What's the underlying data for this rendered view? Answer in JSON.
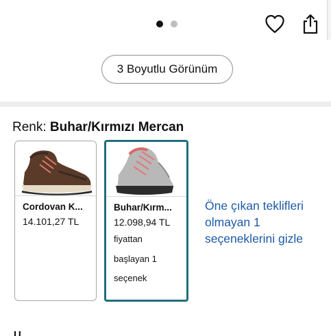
{
  "gallery": {
    "dots_total": 2,
    "active_dot": 1,
    "view_3d_label": "3 Boyutlu Görünüm"
  },
  "color_section": {
    "label_prefix": "Renk: ",
    "selected_color": "Buhar/Kırmızı Mercan",
    "options": [
      {
        "name": "Cordovan K...",
        "price": "14.101,27 TL",
        "extra_lines": []
      },
      {
        "name": "Buhar/Kırm...",
        "price": "12.098,94 TL",
        "extra_lines": [
          "fiyattan",
          "başlayan 1",
          "seçenek"
        ]
      }
    ],
    "hide_link": "Öne çıkan teklifleri olmayan 1 seçeneklerini gizle"
  },
  "colors": {
    "selected_border": "#1f6e7c",
    "link": "#1c5aa6",
    "separator": "#eeeeee"
  },
  "icons": [
    "heart-icon",
    "share-icon",
    "shoe-thumbnail-brown",
    "shoe-thumbnail-grey"
  ]
}
